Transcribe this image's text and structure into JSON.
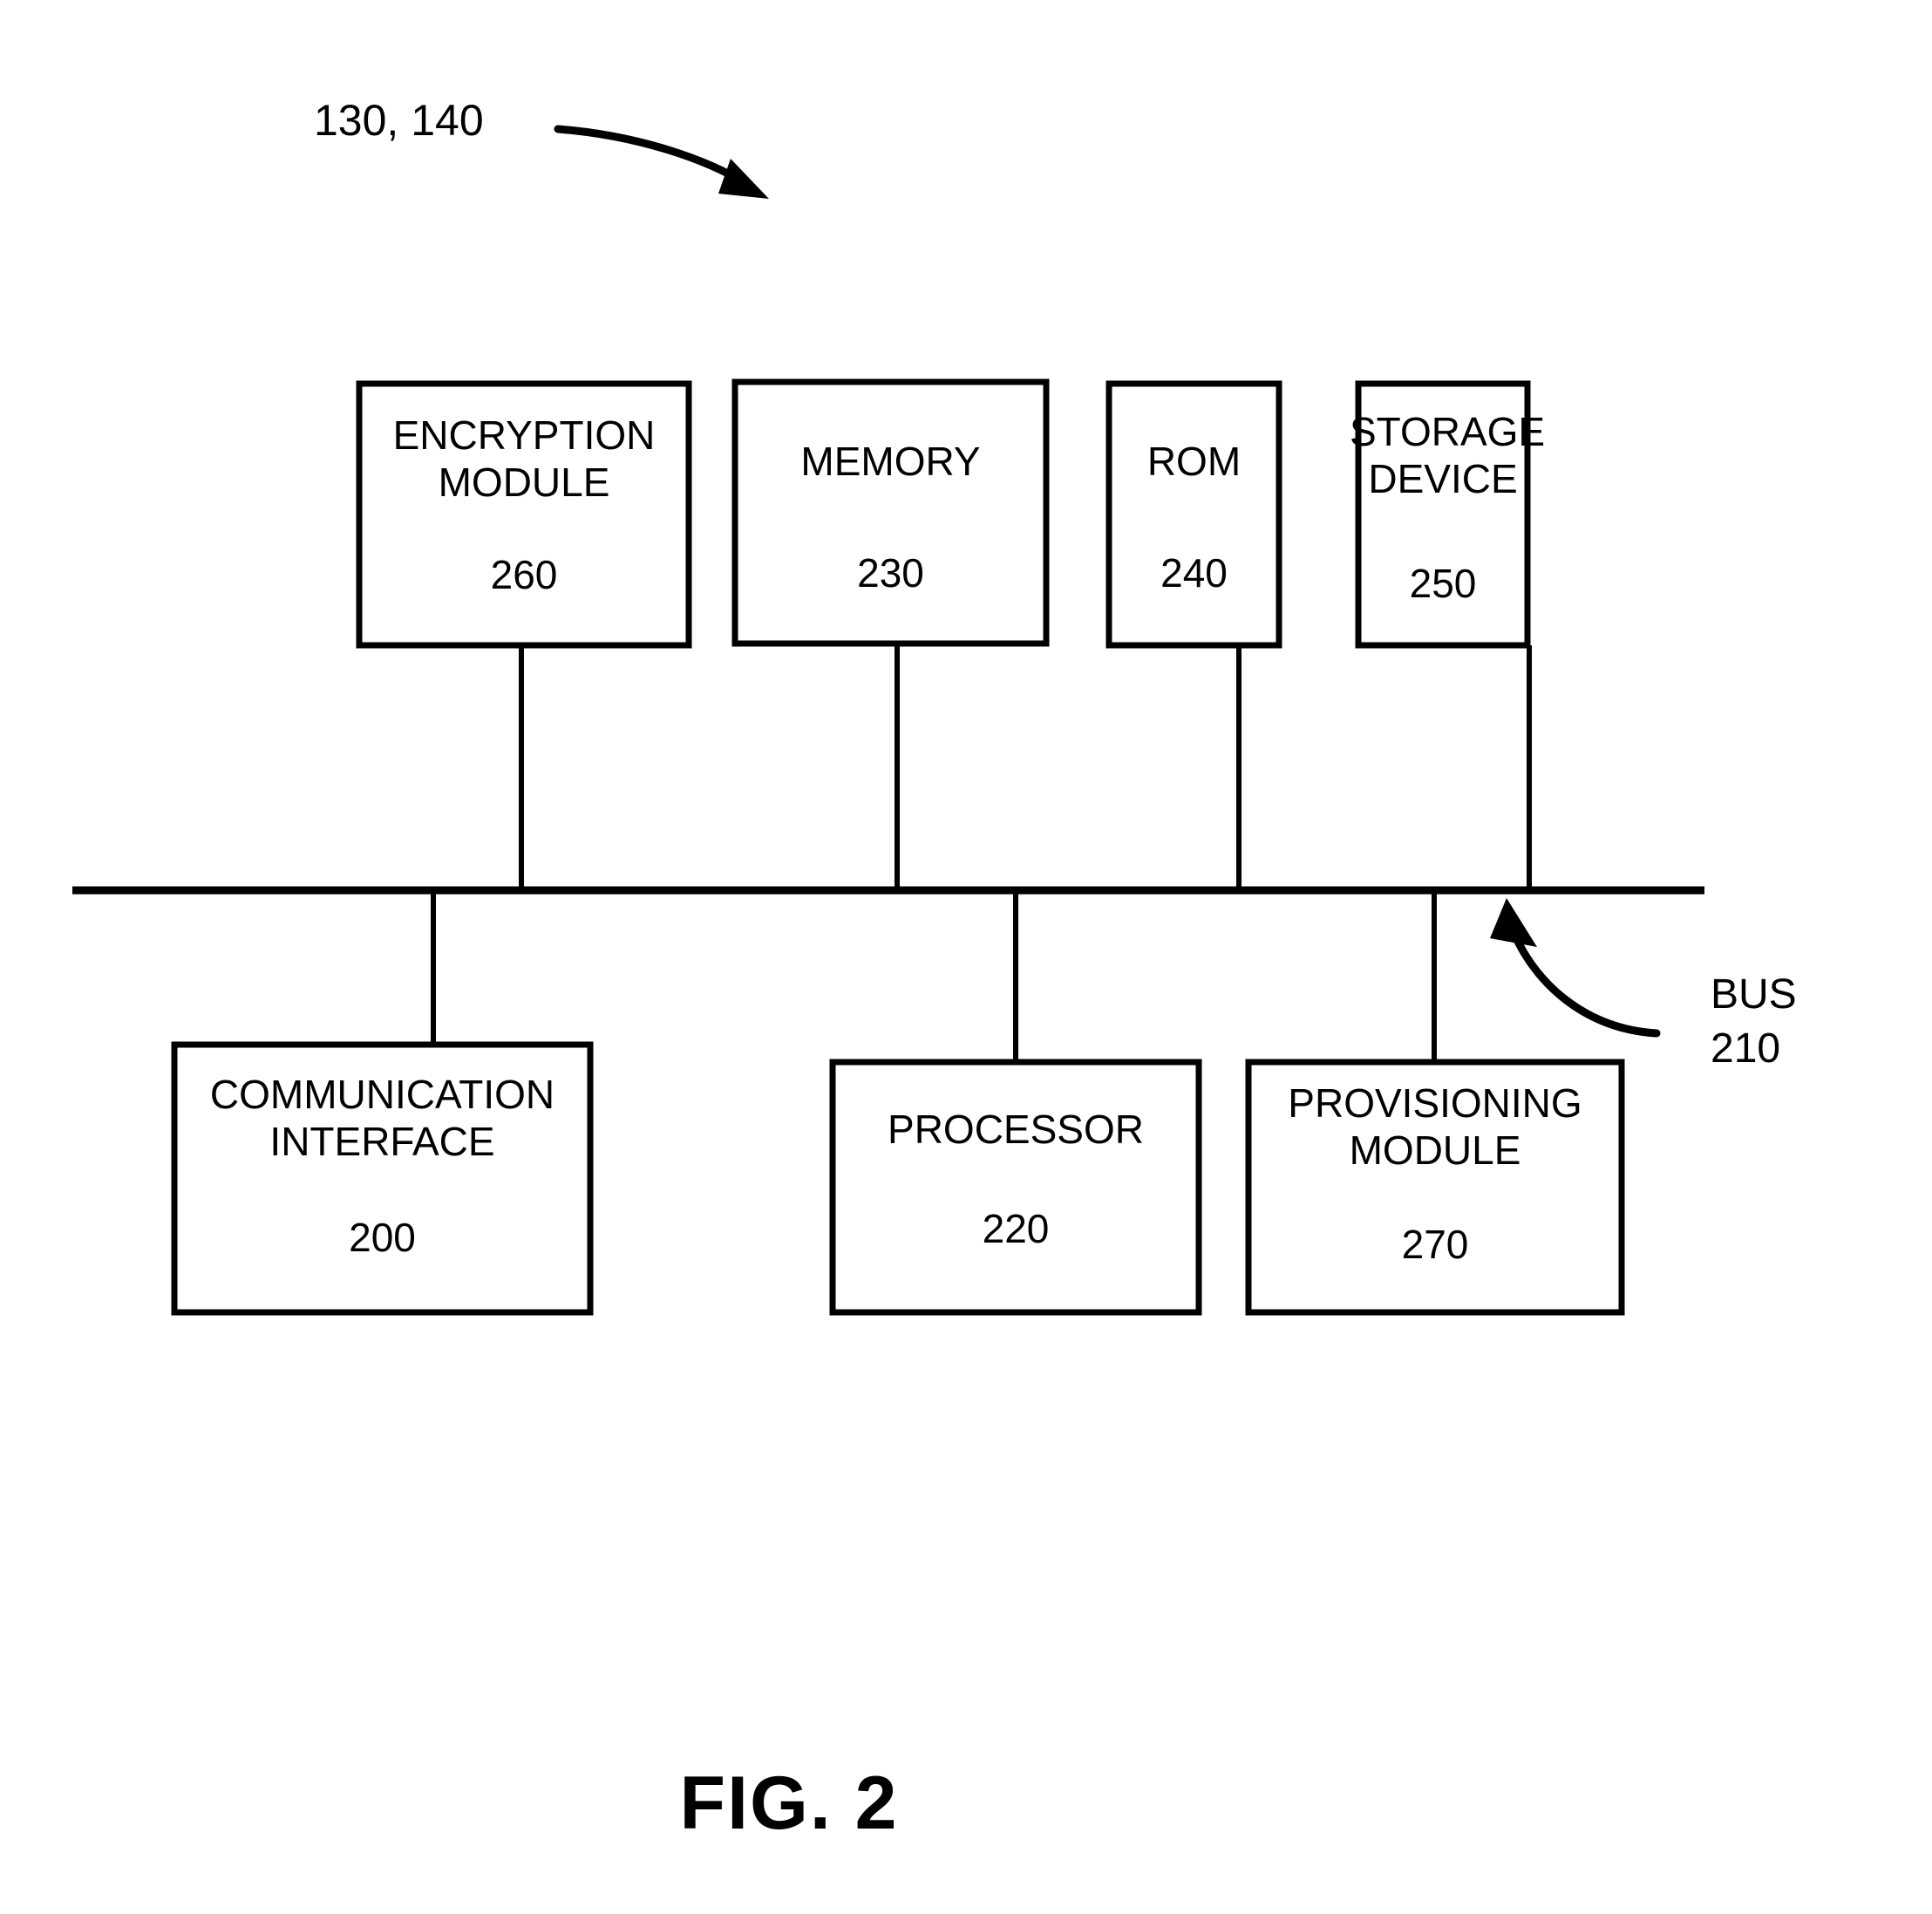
{
  "figure": {
    "caption": "FIG. 2",
    "top_reference": "130, 140",
    "bus": {
      "name": "BUS",
      "number": "210"
    }
  },
  "blocks": [
    {
      "id": "encryption-module",
      "label": "ENCRYPTION\nMODULE",
      "number": "260",
      "row": "top"
    },
    {
      "id": "memory",
      "label": "MEMORY",
      "number": "230",
      "row": "top"
    },
    {
      "id": "rom",
      "label": "ROM",
      "number": "240",
      "row": "top"
    },
    {
      "id": "storage-device",
      "label": "STORAGE\nDEVICE",
      "number": "250",
      "row": "top"
    },
    {
      "id": "communication-interface",
      "label": "COMMUNICATION\nINTERFACE",
      "number": "200",
      "row": "bottom"
    },
    {
      "id": "processor",
      "label": "PROCESSOR",
      "number": "220",
      "row": "bottom"
    },
    {
      "id": "provisioning-module",
      "label": "PROVISIONING\nMODULE",
      "number": "270",
      "row": "bottom"
    }
  ],
  "colors": {
    "ink": "#000000",
    "paper": "#ffffff"
  }
}
